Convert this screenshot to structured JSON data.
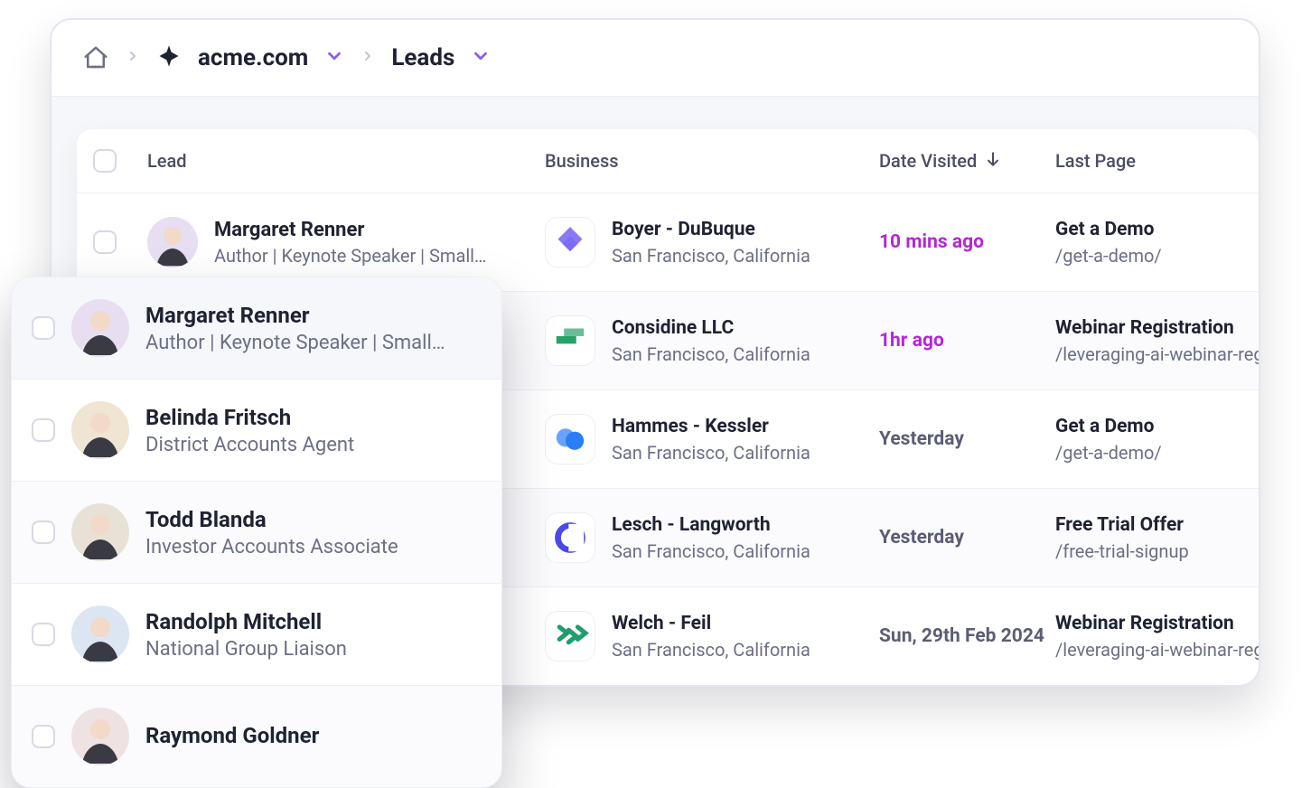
{
  "breadcrumb": {
    "site": "acme.com",
    "section": "Leads"
  },
  "columns": {
    "lead": "Lead",
    "business": "Business",
    "date": "Date Visited",
    "page": "Last Page"
  },
  "rows": [
    {
      "lead_name": "Margaret Renner",
      "lead_sub": "Author | Keynote Speaker | Small…",
      "biz_name": "Boyer - DuBuque",
      "biz_sub": "San Francisco, California",
      "date": "10 mins ago",
      "date_accent": true,
      "page_title": "Get a Demo",
      "page_path": "/get-a-demo/"
    },
    {
      "lead_name": "",
      "lead_sub": "",
      "biz_name": "Considine LLC",
      "biz_sub": "San Francisco, California",
      "date": "1hr ago",
      "date_accent": true,
      "page_title": "Webinar Registration",
      "page_path": "/leveraging-ai-webinar-register/"
    },
    {
      "lead_name": "",
      "lead_sub": "",
      "biz_name": "Hammes - Kessler",
      "biz_sub": "San Francisco, California",
      "date": "Yesterday",
      "date_accent": false,
      "page_title": "Get a Demo",
      "page_path": "/get-a-demo/"
    },
    {
      "lead_name": "",
      "lead_sub": "",
      "biz_name": "Lesch - Langworth",
      "biz_sub": "San Francisco, California",
      "date": "Yesterday",
      "date_accent": false,
      "page_title": "Free Trial Offer",
      "page_path": "/free-trial-signup"
    },
    {
      "lead_name": "",
      "lead_sub": "",
      "biz_name": "Welch - Feil",
      "biz_sub": "San Francisco, California",
      "date": "Sun, 29th Feb 2024",
      "date_accent": false,
      "page_title": "Webinar Registration",
      "page_path": "/leveraging-ai-webinar-register/"
    }
  ],
  "overlay": [
    {
      "name": "Margaret Renner",
      "sub": "Author | Keynote Speaker | Small…"
    },
    {
      "name": "Belinda Fritsch",
      "sub": "District Accounts Agent"
    },
    {
      "name": "Todd Blanda",
      "sub": "Investor Accounts Associate"
    },
    {
      "name": "Randolph Mitchell",
      "sub": "National Group Liaison"
    },
    {
      "name": "Raymond Goldner",
      "sub": ""
    }
  ],
  "logo_colors": [
    "#7c6cf2",
    "#27a36a",
    "#2b7ef5",
    "#4b49e8",
    "#1f9e6d"
  ]
}
